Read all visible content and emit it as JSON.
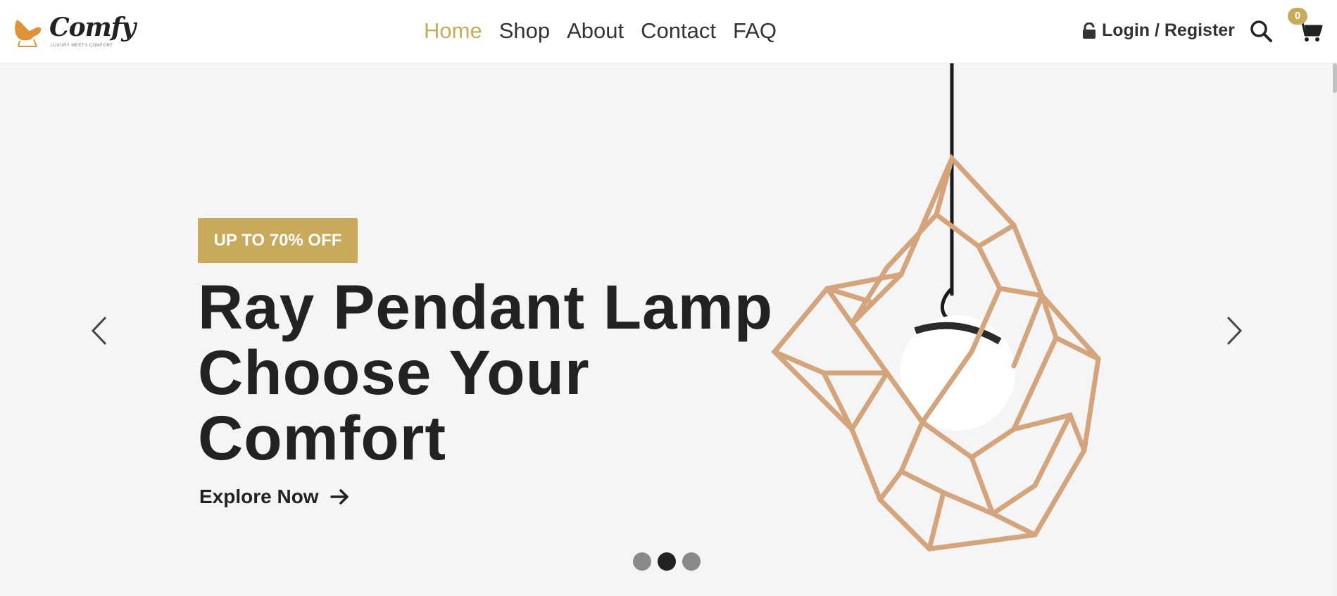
{
  "brand": {
    "name": "Comfy",
    "tagline": "LUXURY MEETS COMFORT",
    "accent_color": "#c9a95c"
  },
  "nav": {
    "items": [
      {
        "label": "Home",
        "active": true
      },
      {
        "label": "Shop",
        "active": false
      },
      {
        "label": "About",
        "active": false
      },
      {
        "label": "Contact",
        "active": false
      },
      {
        "label": "FAQ",
        "active": false
      }
    ]
  },
  "header": {
    "login_label": "Login / Register",
    "login_icon": "lock-icon",
    "search_icon": "search-icon",
    "cart_icon": "cart-icon",
    "cart_count": "0"
  },
  "hero": {
    "badge": "UP TO 70% OFF",
    "title_lines": [
      "Ray Pendant Lamp",
      "Choose Your",
      "Comfort"
    ],
    "cta_label": "Explore Now",
    "cta_icon": "arrow-right-icon",
    "prev_icon": "chevron-left-icon",
    "next_icon": "chevron-right-icon",
    "slide_count": 3,
    "active_slide": 2
  }
}
